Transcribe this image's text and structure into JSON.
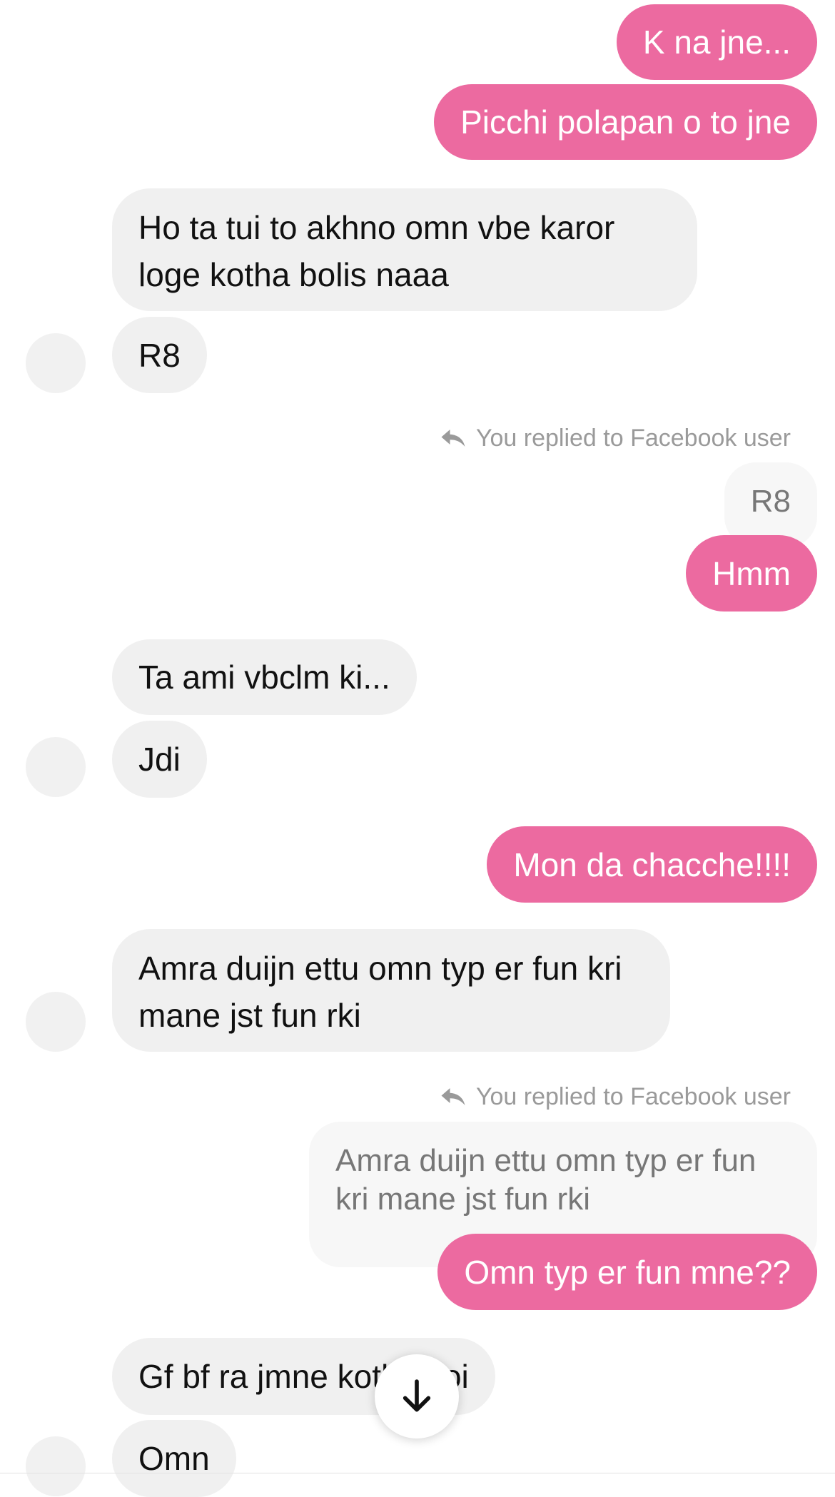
{
  "messages": [
    {
      "text": "K na jne..."
    },
    {
      "text": "Picchi polapan o to jne"
    },
    {
      "text": "Ho ta tui to akhno omn vbe karor loge kotha bolis naaa"
    },
    {
      "text": "R8"
    },
    {
      "text": "Hmm"
    },
    {
      "text": "Ta ami vbclm ki..."
    },
    {
      "text": "Jdi"
    },
    {
      "text": "Mon da chacche!!!!"
    },
    {
      "text": "Amra duijn ettu omn typ er fun kri mane jst fun rki"
    },
    {
      "text": "Omn typ er fun mne??"
    },
    {
      "text": "Gf bf ra jmne kotha koi"
    },
    {
      "text": "Omn"
    }
  ],
  "replies": [
    {
      "label": "You replied to Facebook user",
      "quoted": "R8"
    },
    {
      "label": "You replied to Facebook user",
      "quoted": "Amra duijn ettu omn typ er fun kri mane jst fun rki"
    }
  ],
  "icons": {
    "reply": "reply-arrow-icon",
    "scroll": "arrow-down-icon"
  },
  "colors": {
    "outgoing_bubble": "#ec6aa0",
    "incoming_bubble": "#f0f0f0",
    "quote_bubble": "#f7f7f7",
    "meta_text": "#9a9a9a"
  }
}
